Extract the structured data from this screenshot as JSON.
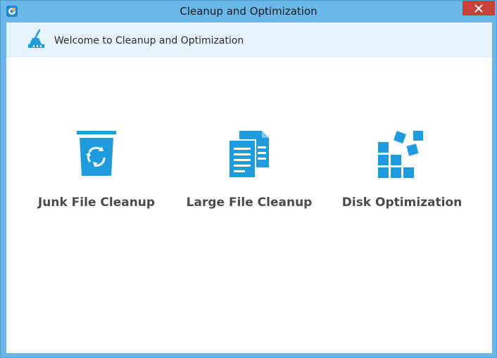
{
  "window": {
    "title": "Cleanup and Optimization",
    "close_glyph": "✕"
  },
  "header": {
    "welcome_text": "Welcome to Cleanup and Optimization",
    "icon": "broom-icon"
  },
  "options": [
    {
      "label": "Junk File Cleanup",
      "icon": "recycle-bin-icon"
    },
    {
      "label": "Large File Cleanup",
      "icon": "documents-icon"
    },
    {
      "label": "Disk Optimization",
      "icon": "blocks-icon"
    }
  ],
  "colors": {
    "frame": "#6ab7ea",
    "close": "#c7413a",
    "accent": "#1e9bdc",
    "header_bg": "#e8f2fc",
    "label": "#4a4a4a"
  }
}
